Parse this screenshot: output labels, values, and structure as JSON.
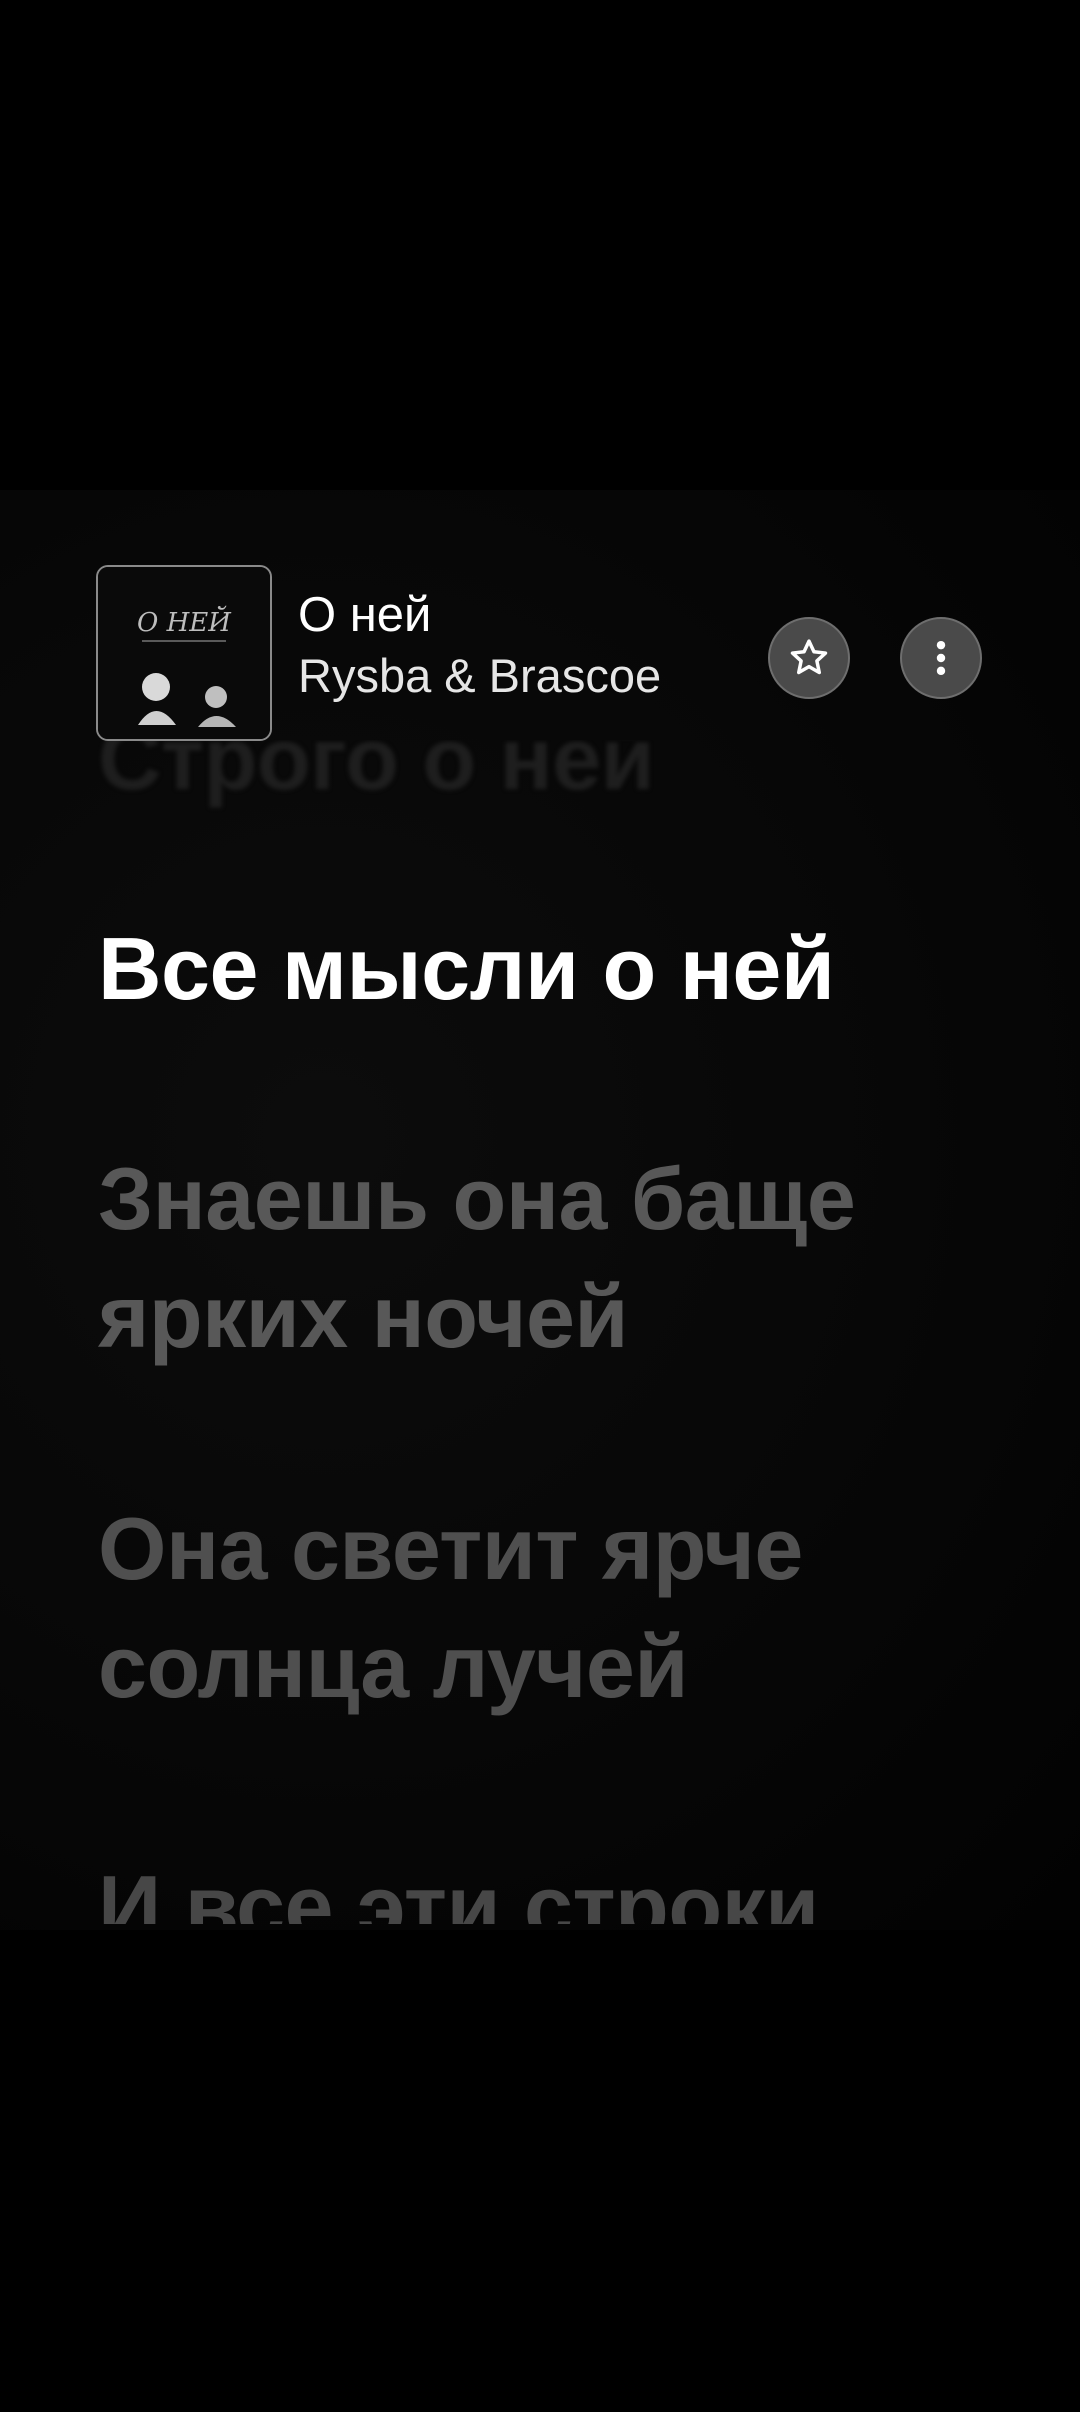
{
  "now_playing": {
    "title": "О ней",
    "artist": "Rysba & Brascoe",
    "album_art_text": "О НЕЙ",
    "favorite_icon": "star-icon",
    "more_icon": "vertical-dots-icon"
  },
  "lyrics": {
    "previous_line": "Строго о ней",
    "current_line": "Все мысли о ней",
    "upcoming_lines": [
      "Знаешь она баще\nярких ночей",
      "Она светит ярче\nсолнца лучей",
      "И все эти строки"
    ]
  }
}
